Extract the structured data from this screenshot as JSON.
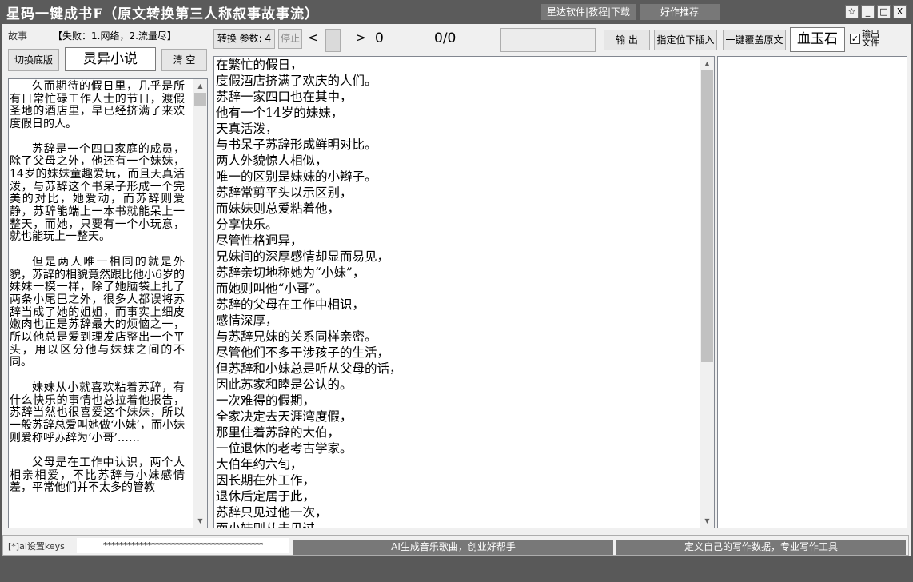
{
  "window": {
    "title": "星码一键成书F（原文转换第三人称叙事故事流）",
    "links": [
      "星达软件|教程|下载",
      "好作推荐"
    ],
    "controls": [
      "☆",
      "_",
      "□",
      "X"
    ]
  },
  "left_panel": {
    "mode_label": "故事",
    "hint": "【失败：1.网络，2.流量尽】",
    "switch_button": "切换底版",
    "genre_value": "灵异小说",
    "clear_button": "清 空",
    "story_paragraphs": [
      "久而期待的假日里，几乎是所有日常忙碌工作人士的节日，渡假圣地的酒店里，早已经挤满了来欢度假日的人。",
      "苏辞是一个四口家庭的成员，除了父母之外，他还有一个妹妹，14岁的妹妹童趣爱玩，而且天真活泼，与苏辞这个书呆子形成一个完美的对比，她爱动，而苏辞则爱静，苏辞能端上一本书就能呆上一整天，而她，只要有一个小玩意，就也能玩上一整天。",
      "但是两人唯一相同的就是外貌，苏辞的相貌竟然跟比他小6岁的妹妹一模一样，除了她脑袋上扎了两条小尾巴之外，很多人都误将苏辞当成了她的姐姐，而事实上细皮嫩肉也正是苏辞最大的烦恼之一，所以他总是爱到理发店整出一个平头，用以区分他与妹妹之间的不同。",
      "妹妹从小就喜欢粘着苏辞，有什么快乐的事情也总拉着他报告，苏辞当然也很喜爱这个妹妹，所以一般苏辞总爱叫她做‘小妹’，而小妹则爱称呼苏辞为‘小哥’……",
      "父母是在工作中认识，两个人相亲相爱，不比苏辞与小妹感情差，平常他们并不太多的管教"
    ]
  },
  "toolbar": {
    "convert_label": "转换",
    "params_label": "参数: 4",
    "stop_label": "停止",
    "prev": "<",
    "next": ">",
    "counter": "0",
    "progress": "0/0",
    "output_button": "输 出",
    "insert_button": "指定位下插入",
    "overwrite_button": "一键覆盖原文",
    "voice_value": "血玉石",
    "output_file_label": "输出文件",
    "output_file_checked": true
  },
  "output_lines": [
    "在繁忙的假日，",
    "度假酒店挤满了欢庆的人们。",
    "苏辞一家四口也在其中，",
    "他有一个14岁的妹妹，",
    "天真活泼，",
    "与书呆子苏辞形成鲜明对比。",
    "两人外貌惊人相似，",
    "唯一的区别是妹妹的小辫子。",
    "苏辞常剪平头以示区别，",
    "而妹妹则总爱粘着他，",
    "分享快乐。",
    "尽管性格迥异，",
    "兄妹间的深厚感情却显而易见，",
    "苏辞亲切地称她为“小妹”，",
    "而她则叫他“小哥”。",
    "苏辞的父母在工作中相识，",
    "感情深厚，",
    "与苏辞兄妹的关系同样亲密。",
    "尽管他们不多干涉孩子的生活，",
    "但苏辞和小妹总是听从父母的话，",
    "因此苏家和睦是公认的。",
    "一次难得的假期，",
    "全家决定去天涯湾度假，",
    "那里住着苏辞的大伯，",
    "一位退休的老考古学家。",
    "大伯年约六旬，",
    "因长期在外工作，",
    "退休后定居于此，",
    "苏辞只见过他一次，",
    "而小妹则从未见过。"
  ],
  "footer": {
    "keys_label": "[*]ai设置keys",
    "keys_value": "****************************************",
    "ai_music_button": "AI生成音乐歌曲，创业好帮手",
    "custom_data_button": "定义自己的写作数据，专业写作工具"
  }
}
